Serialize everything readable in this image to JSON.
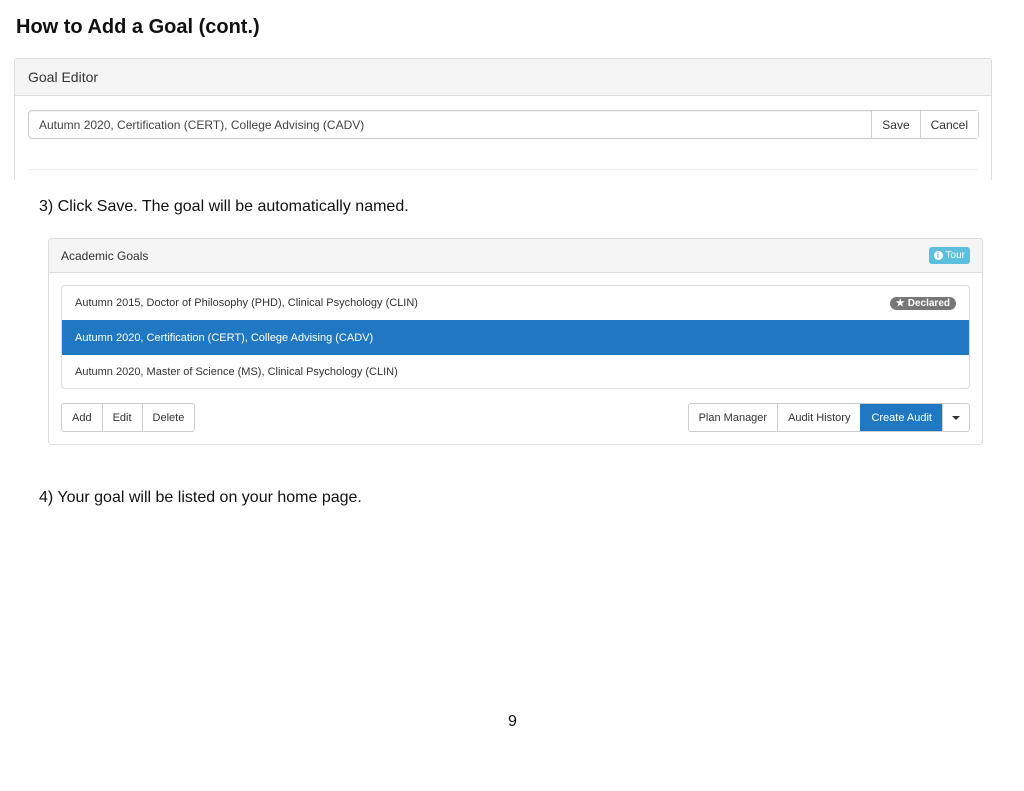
{
  "document": {
    "title": "How to Add a Goal (cont.)",
    "steps": [
      "3) Click Save. The goal will be automatically named.",
      "4) Your goal will be listed on your home page."
    ],
    "page_number": "9"
  },
  "goal_editor": {
    "heading": "Goal Editor",
    "input_value": "Autumn 2020, Certification (CERT), College Advising (CADV)",
    "save_label": "Save",
    "cancel_label": "Cancel"
  },
  "academic_goals": {
    "heading": "Academic Goals",
    "tour_label": "Tour",
    "tour_icon": "info-circle-icon",
    "accent_color": "#1f78c1",
    "goals": [
      {
        "label": "Autumn 2015, Doctor of Philosophy (PHD), Clinical Psychology (CLIN)",
        "badge": "Declared",
        "badge_icon": "star-icon",
        "selected": false
      },
      {
        "label": "Autumn 2020, Certification (CERT), College Advising (CADV)",
        "badge": "",
        "selected": true
      },
      {
        "label": "Autumn 2020, Master of Science (MS), Clinical Psychology (CLIN)",
        "badge": "",
        "selected": false
      }
    ],
    "left_buttons": [
      "Add",
      "Edit",
      "Delete"
    ],
    "right_buttons": [
      "Plan Manager",
      "Audit History",
      "Create Audit"
    ],
    "dropdown_icon": "caret-down-icon"
  }
}
